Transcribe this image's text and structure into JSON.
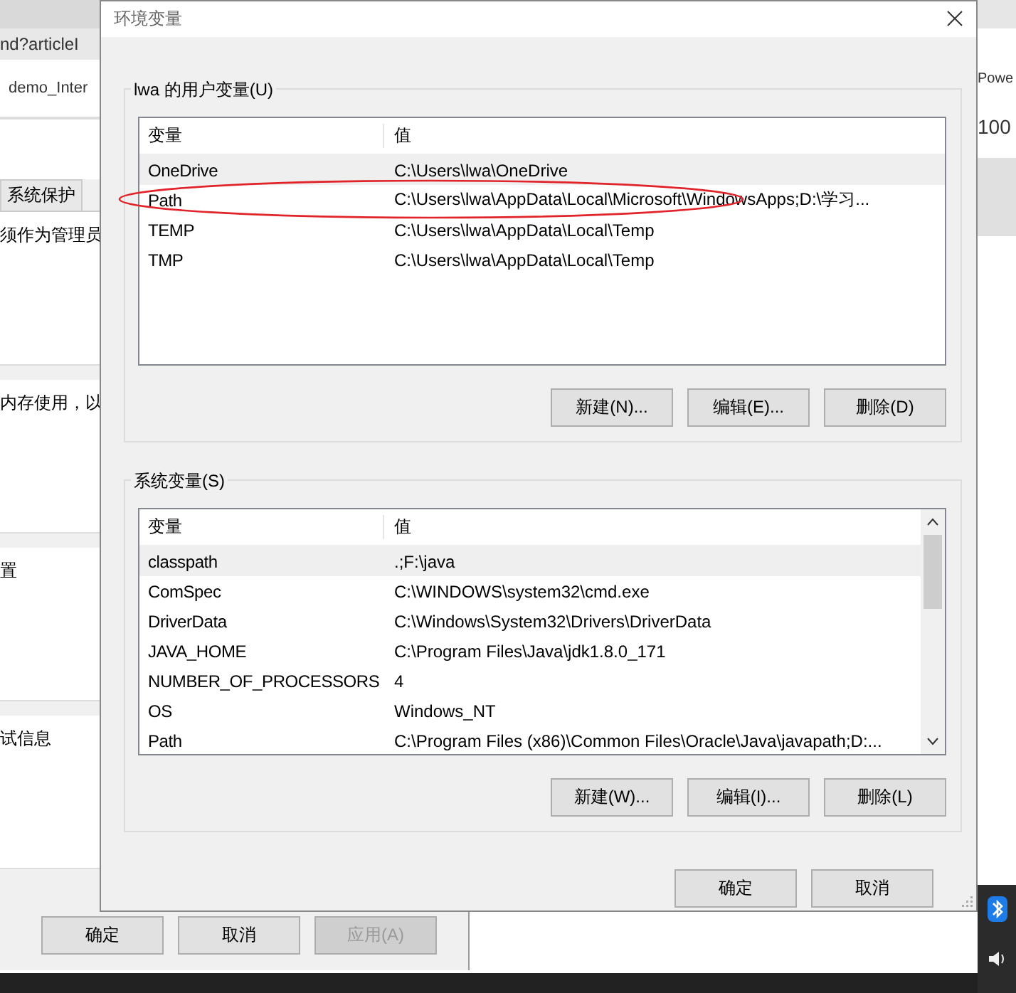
{
  "background": {
    "address": "nd?articleI",
    "tab": "demo_Inter",
    "right_tab": "Powe",
    "right_value": "100",
    "system_tab": "系统保护",
    "notes": [
      "须作为管理员",
      "内存使用，以",
      "置",
      "试信息"
    ],
    "buttons": [
      {
        "label": "确定",
        "disabled": false
      },
      {
        "label": "取消",
        "disabled": false
      },
      {
        "label": "应用(A)",
        "disabled": true
      }
    ]
  },
  "window": {
    "title": "环境变量"
  },
  "user_vars": {
    "title": "lwa 的用户变量(U)",
    "columns": [
      "变量",
      "值"
    ],
    "rows": [
      {
        "name": "OneDrive",
        "value": "C:\\Users\\lwa\\OneDrive",
        "selected": true
      },
      {
        "name": "Path",
        "value": "C:\\Users\\lwa\\AppData\\Local\\Microsoft\\WindowsApps;D:\\学习...",
        "selected": false
      },
      {
        "name": "TEMP",
        "value": "C:\\Users\\lwa\\AppData\\Local\\Temp",
        "selected": false
      },
      {
        "name": "TMP",
        "value": "C:\\Users\\lwa\\AppData\\Local\\Temp",
        "selected": false
      }
    ],
    "buttons": [
      "新建(N)...",
      "编辑(E)...",
      "删除(D)"
    ]
  },
  "system_vars": {
    "title": "系统变量(S)",
    "columns": [
      "变量",
      "值"
    ],
    "rows": [
      {
        "name": "classpath",
        "value": ".;F:\\java",
        "selected": true
      },
      {
        "name": "ComSpec",
        "value": "C:\\WINDOWS\\system32\\cmd.exe",
        "selected": false
      },
      {
        "name": "DriverData",
        "value": "C:\\Windows\\System32\\Drivers\\DriverData",
        "selected": false
      },
      {
        "name": "JAVA_HOME",
        "value": "C:\\Program Files\\Java\\jdk1.8.0_171",
        "selected": false
      },
      {
        "name": "NUMBER_OF_PROCESSORS",
        "value": "4",
        "selected": false
      },
      {
        "name": "OS",
        "value": "Windows_NT",
        "selected": false
      },
      {
        "name": "Path",
        "value": "C:\\Program Files (x86)\\Common Files\\Oracle\\Java\\javapath;D:...",
        "selected": false
      }
    ],
    "buttons": [
      "新建(W)...",
      "编辑(I)...",
      "删除(L)"
    ]
  },
  "buttons": [
    "确定",
    "取消"
  ]
}
